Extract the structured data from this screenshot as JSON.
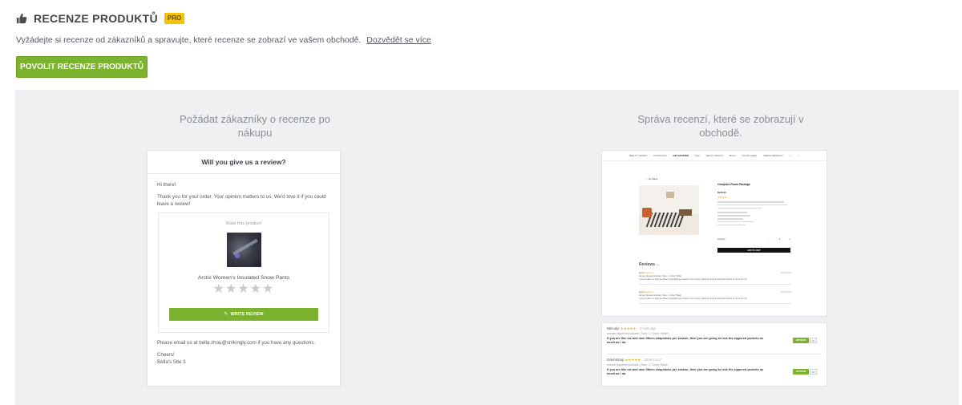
{
  "header": {
    "title": "RECENZE PRODUKTŮ",
    "badge": "PRO",
    "subtitle": "Vyžádejte si recenze od zákazníků a spravujte, které recenze se zobrazí ve vašem obchodě.",
    "learn_more": "Dozvědět se více",
    "enable_button": "POVOLIT RECENZE PRODUKTŮ"
  },
  "columns": {
    "left_title": "Požádat zákazníky o recenze po nákupu",
    "right_title": "Správa recenzí, které se zobrazují v obchodě."
  },
  "email": {
    "heading": "Will you give us a review?",
    "greeting": "Hi there!",
    "message": "Thank you for your order. Your opinion matters to us. We'd love it if you could leave a review!",
    "rate_label": "Rate this product",
    "product_name": "Arctix Women's Insulated Snow Pants",
    "stars": "★★★★★",
    "write_review": "WRITE REVIEW",
    "contact": "Please email us at bella.zhou@strikingly.com if you have any questions.",
    "closing": "Cheers!",
    "signature": "Bella's Site 3"
  },
  "shop": {
    "nav": [
      "BEAUTY WORKS",
      "PORTFOLIO",
      "GET STARTED",
      "FAQ",
      "ABOUT DESIGN",
      "BLOG",
      "SOCIAL FEED",
      "SIMPLE PRODUCT"
    ],
    "nav_active": "GET STARTED",
    "back": "← Go Back",
    "product_title": "Complete Room Package",
    "price": "$245.00",
    "stars": "★★★★☆",
    "qty_label": "Quantity",
    "qty": "−  1  +",
    "add_to_cart": "ADD TO CART",
    "reviews_title": "Reviews",
    "reviews_count": "11",
    "reviews": [
      {
        "author": "gplna",
        "stars": "★★★★★",
        "attrs": "women zippered pockets | Size: L | Color: White",
        "text": "If you are like me and lose fifteen chapsticks per season, then you are going to love the zippered pockets as much as I do.",
        "date": "2019-12-27"
      },
      {
        "author": "gplna",
        "stars": "★★★★★",
        "attrs": "women zippered pockets | Size: L | Color: Black",
        "text": "If you are like me and lose fifteen chapsticks per season, then you are going to love the zippered pockets as much as I do.",
        "date": "2019-12-27"
      }
    ]
  },
  "admin": {
    "approve": "APPROVE",
    "more": "•••",
    "items": [
      {
        "author": "Bbeudyr",
        "stars": "★★★★★",
        "date": "3 mins ago",
        "attrs": "women zippered pockets  |  Size: L  |  Color: White",
        "text": "If you are like me and lose fifteen chapsticks per season, then you are going to love the zippered pockets as much as I do."
      },
      {
        "author": "Dokinrdoop",
        "stars": "★★★★★",
        "date": "2019-12-27",
        "attrs": "women zippered pockets  |  Size: L  |  Color: Black",
        "text": "If you are like me and lose fifteen chapsticks per season, then you are going to love the zippered pockets as much as I do."
      }
    ]
  },
  "colors": {
    "accent": "#7bb32e",
    "badge": "#f4c400",
    "panel": "#eef0f2"
  }
}
